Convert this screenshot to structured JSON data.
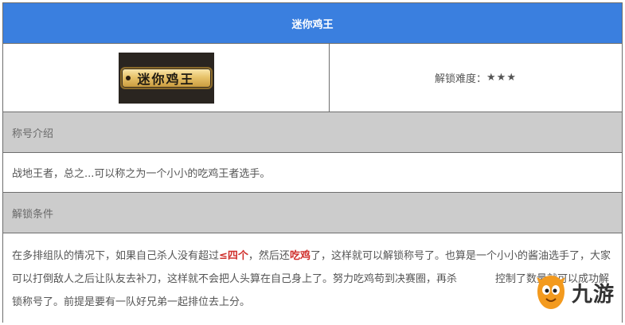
{
  "title": "迷你鸡王",
  "badge_text": "迷你鸡王",
  "difficulty": {
    "label": "解锁难度：",
    "stars": "★★★"
  },
  "intro": {
    "heading": "称号介绍",
    "text": "战地王者，总之...可以称之为一个小小的吃鸡王者选手。"
  },
  "unlock": {
    "heading": "解锁条件",
    "text_parts": [
      "在多排组队的情况下，如果自己杀人没有超过",
      "≤四个",
      "，然后还",
      "吃鸡",
      "了，这样就可以解锁称号了。也算是一个小小的酱油选手了，大家可以打倒敌人之后让队友去补刀，这样就不会把人头算在自己身上了。努力吃鸡苟到决赛圈，再杀",
      "控制了数量就可以成功解锁称号了。前提是要有一队好兄弟一起排位去上分。"
    ]
  },
  "watermark": {
    "text": "九游",
    "icon": "mascot-icon"
  },
  "colors": {
    "header": "#3a7fdf",
    "section": "#cccccc",
    "highlight": "#d0312d"
  }
}
